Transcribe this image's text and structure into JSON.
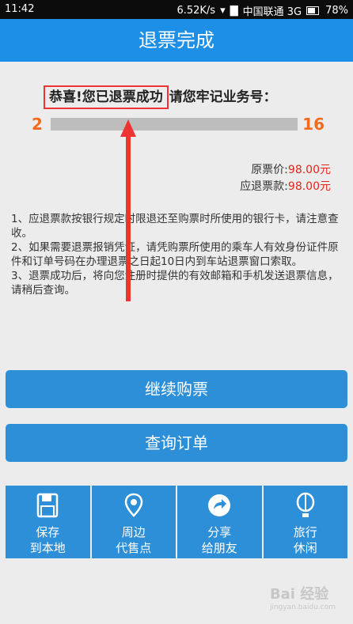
{
  "status_bar": {
    "time": "11:42",
    "speed": "6.52K/s",
    "carrier": "中国联通 3G",
    "battery": "78%"
  },
  "title": "退票完成",
  "congrats": {
    "highlight": "恭喜!您已退票成功",
    "rest": "请您牢记业务号："
  },
  "order_number": {
    "first_digit": "2",
    "last_digits": "16"
  },
  "prices": {
    "original_label": "原票价:",
    "original_value": "98.00元",
    "refund_label": "应退票款:",
    "refund_value": "98.00元"
  },
  "notes": [
    "1、应退票款按银行规定时限退还至购票时所使用的银行卡，请注意查收。",
    "2、如果需要退票报销凭证，请凭购票所使用的乘车人有效身份证件原件和订单号码在办理退票之日起10日内到车站退票窗口索取。",
    "3、退票成功后，将向您注册时提供的有效邮箱和手机发送退票信息，请稍后查询。"
  ],
  "buttons": {
    "continue": "继续购票",
    "query": "查询订单"
  },
  "tiles": [
    {
      "line1": "保存",
      "line2": "到本地",
      "icon": "save-icon"
    },
    {
      "line1": "周边",
      "line2": "代售点",
      "icon": "location-pin-icon"
    },
    {
      "line1": "分享",
      "line2": "给朋友",
      "icon": "share-icon"
    },
    {
      "line1": "旅行",
      "line2": "休闲",
      "icon": "balloon-icon"
    }
  ],
  "watermark": {
    "text": "Bai 经验",
    "sub": "jingyan.baidu.com"
  },
  "colors": {
    "accent": "#1d8fe6",
    "button": "#2d8fd8",
    "order_digit": "#f26b1d",
    "price": "#e0261b",
    "annotation": "#e33"
  }
}
